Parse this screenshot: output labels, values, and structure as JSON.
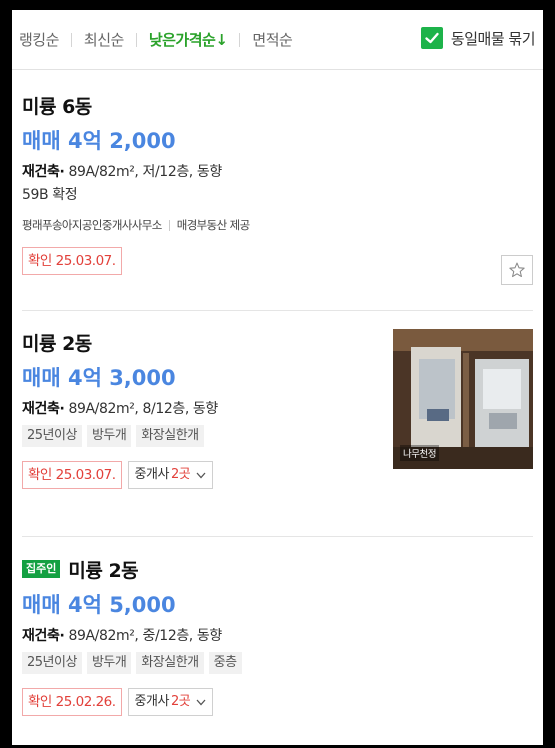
{
  "sort": {
    "items": [
      "랭킹순",
      "최신순",
      "낮은가격순↓",
      "면적순"
    ],
    "active_index": 2,
    "group_toggle_label": "동일매물 묶기",
    "group_toggle_checked": true
  },
  "listings": [
    {
      "title": "미륭 6동",
      "price": "매매 4억 2,000",
      "spec_label": "재건축",
      "spec_detail": "89A/82m², 저/12층, 동향",
      "description": "59B 확정",
      "agent_name": "평래푸송아지공인중개사사무소",
      "agent_source": "매경부동산 제공",
      "confirmed": "확인 25.03.07.",
      "favorite_icon": "star-outline-icon"
    },
    {
      "title": "미륭 2동",
      "price": "매매 4억 3,000",
      "spec_label": "재건축",
      "spec_detail": "89A/82m², 8/12층, 동향",
      "tags": [
        "25년이상",
        "방두개",
        "화장실한개"
      ],
      "confirmed": "확인 25.03.07.",
      "broker_label": "중개사",
      "broker_count": "2곳",
      "thumbnail_label": "나무천정"
    },
    {
      "owner_badge": "집주인",
      "title": "미륭 2동",
      "price": "매매 4억 5,000",
      "spec_label": "재건축",
      "spec_detail": "89A/82m², 중/12층, 동향",
      "tags": [
        "25년이상",
        "방두개",
        "화장실한개",
        "중층"
      ],
      "confirmed": "확인 25.02.26.",
      "broker_label": "중개사",
      "broker_count": "2곳"
    }
  ],
  "colors": {
    "active_sort": "#2aa22a",
    "price": "#4a86e0",
    "confirm": "#e2403a",
    "checkbox": "#1db34a",
    "owner_badge": "#13a042"
  }
}
